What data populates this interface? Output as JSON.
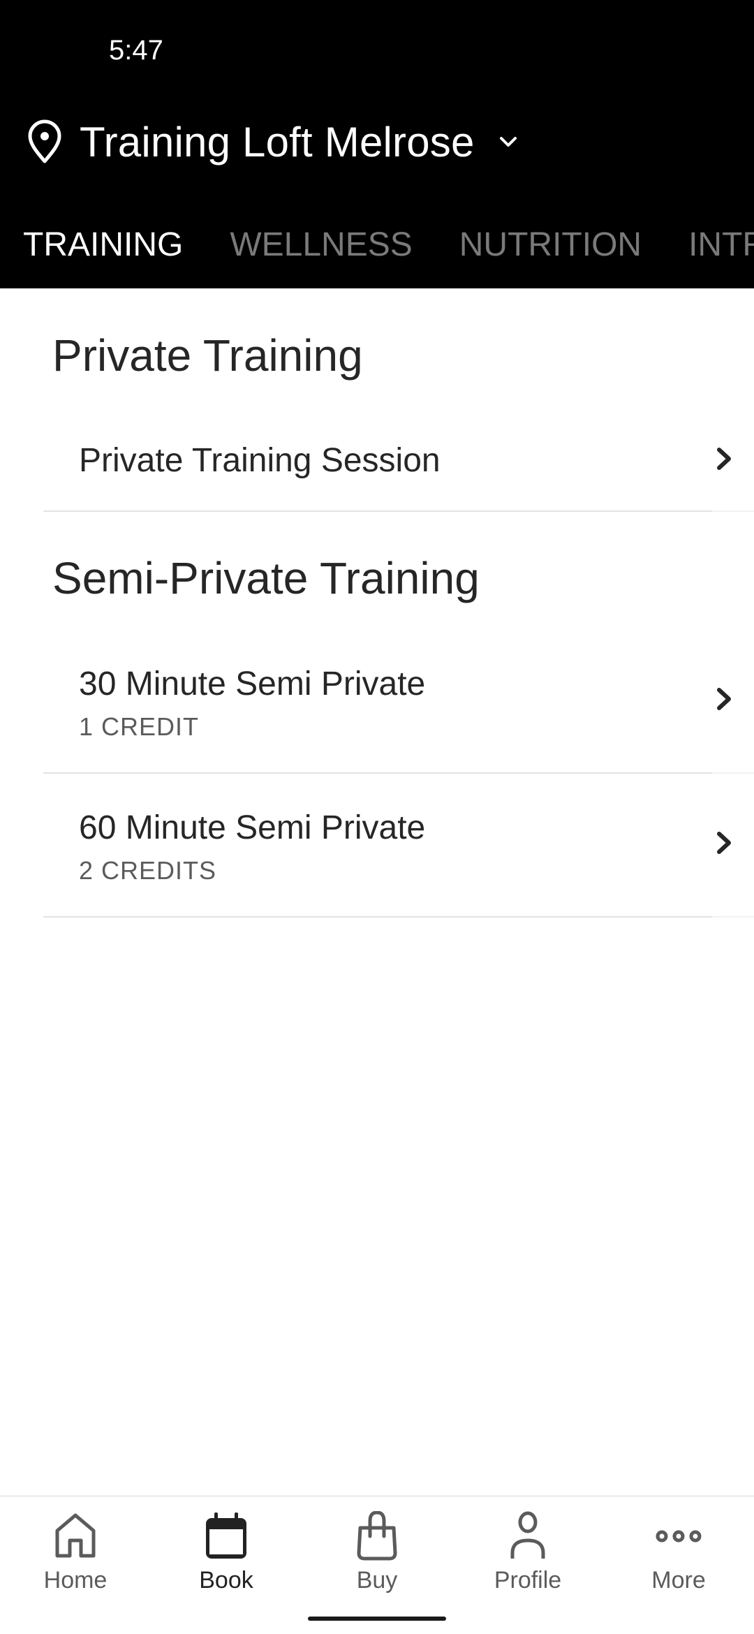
{
  "status_bar": {
    "time": "5:47"
  },
  "header": {
    "location_icon": "map-pin-icon",
    "location_name": "Training Loft Melrose",
    "dropdown_icon": "chevron-down-icon"
  },
  "tabs": [
    {
      "label": "TRAINING",
      "active": true
    },
    {
      "label": "WELLNESS",
      "active": false
    },
    {
      "label": "NUTRITION",
      "active": false
    },
    {
      "label": "INTRO",
      "active": false
    }
  ],
  "sections": [
    {
      "title": "Private Training",
      "items": [
        {
          "title": "Private Training Session",
          "subtitle": ""
        }
      ]
    },
    {
      "title": "Semi-Private Training",
      "items": [
        {
          "title": "30 Minute Semi Private",
          "subtitle": "1 CREDIT"
        },
        {
          "title": "60 Minute Semi Private",
          "subtitle": "2 CREDITS"
        }
      ]
    }
  ],
  "bottom_nav": [
    {
      "label": "Home",
      "icon": "home-icon",
      "active": false
    },
    {
      "label": "Book",
      "icon": "calendar-icon",
      "active": true
    },
    {
      "label": "Buy",
      "icon": "shopping-bag-icon",
      "active": false
    },
    {
      "label": "Profile",
      "icon": "person-icon",
      "active": false
    },
    {
      "label": "More",
      "icon": "more-dots-icon",
      "active": false
    }
  ],
  "colors": {
    "header_bg": "#000000",
    "tab_active": "#ffffff",
    "tab_inactive": "#7a7a7a",
    "text_primary": "#262626",
    "text_secondary": "#5b5b5b",
    "divider": "#e3e3e3"
  }
}
